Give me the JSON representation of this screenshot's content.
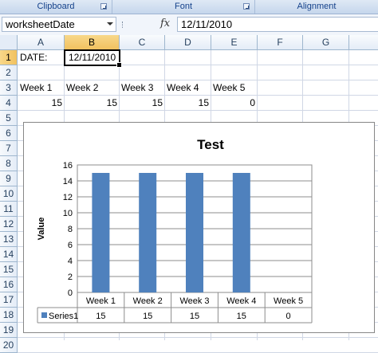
{
  "ribbon": {
    "groups": [
      {
        "label": "Clipboard"
      },
      {
        "label": "Font"
      },
      {
        "label": "Alignment"
      }
    ]
  },
  "formula_bar": {
    "name_box": "worksheetDate",
    "fx_label": "fx",
    "value": "12/11/2010"
  },
  "sheet": {
    "columns": [
      "A",
      "B",
      "C",
      "D",
      "E",
      "F",
      "G"
    ],
    "rows": [
      "1",
      "2",
      "3",
      "4",
      "5",
      "6",
      "7",
      "8",
      "9",
      "10",
      "11",
      "12",
      "13",
      "14",
      "15",
      "16",
      "17",
      "18",
      "19",
      "20"
    ],
    "selected_column": "B",
    "selected_row": "1",
    "cells": {
      "a1": "DATE:",
      "b1": "12/11/2010",
      "a3": "Week 1",
      "b3": "Week 2",
      "c3": "Week 3",
      "d3": "Week 4",
      "e3": "Week 5",
      "a4": "15",
      "b4": "15",
      "c4": "15",
      "d4": "15",
      "e4": "0"
    }
  },
  "chart_data": {
    "type": "bar",
    "title": "Test",
    "ylabel": "Value",
    "xlabel": "",
    "categories": [
      "Week 1",
      "Week 2",
      "Week 3",
      "Week 4",
      "Week 5"
    ],
    "series": [
      {
        "name": "Series1",
        "values": [
          15,
          15,
          15,
          15,
          0
        ],
        "color": "#4f81bd"
      }
    ],
    "ylim": [
      0,
      16
    ],
    "yticks": [
      0,
      2,
      4,
      6,
      8,
      10,
      12,
      14,
      16
    ],
    "grid": true,
    "legend": "data-table",
    "data_table": true
  }
}
